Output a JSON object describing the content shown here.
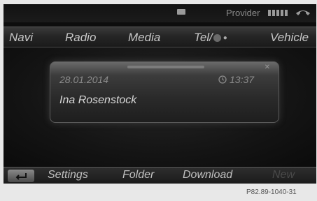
{
  "status_bar": {
    "message_icon": "envelope-icon",
    "provider_label": "Provider",
    "signal_icon": "signal-strength-icon",
    "phone_icon": "phone-handset-icon"
  },
  "top_menu": {
    "items": [
      {
        "label": "Navi"
      },
      {
        "label": "Radio"
      },
      {
        "label": "Media"
      },
      {
        "label": "Tel/"
      },
      {
        "label": "Vehicle"
      }
    ]
  },
  "notification": {
    "date": "28.01.2014",
    "time": "13:37",
    "sender": "Ina Rosenstock"
  },
  "bottom_menu": {
    "items": [
      {
        "label": "Settings"
      },
      {
        "label": "Folder"
      },
      {
        "label": "Download"
      },
      {
        "label": "New"
      }
    ]
  },
  "figure_ref": "P82.89-1040-31",
  "colors": {
    "screen_background": "#0d0d0d",
    "menu_text": "#c8c8c8",
    "page_background": "#e8e8e8"
  }
}
